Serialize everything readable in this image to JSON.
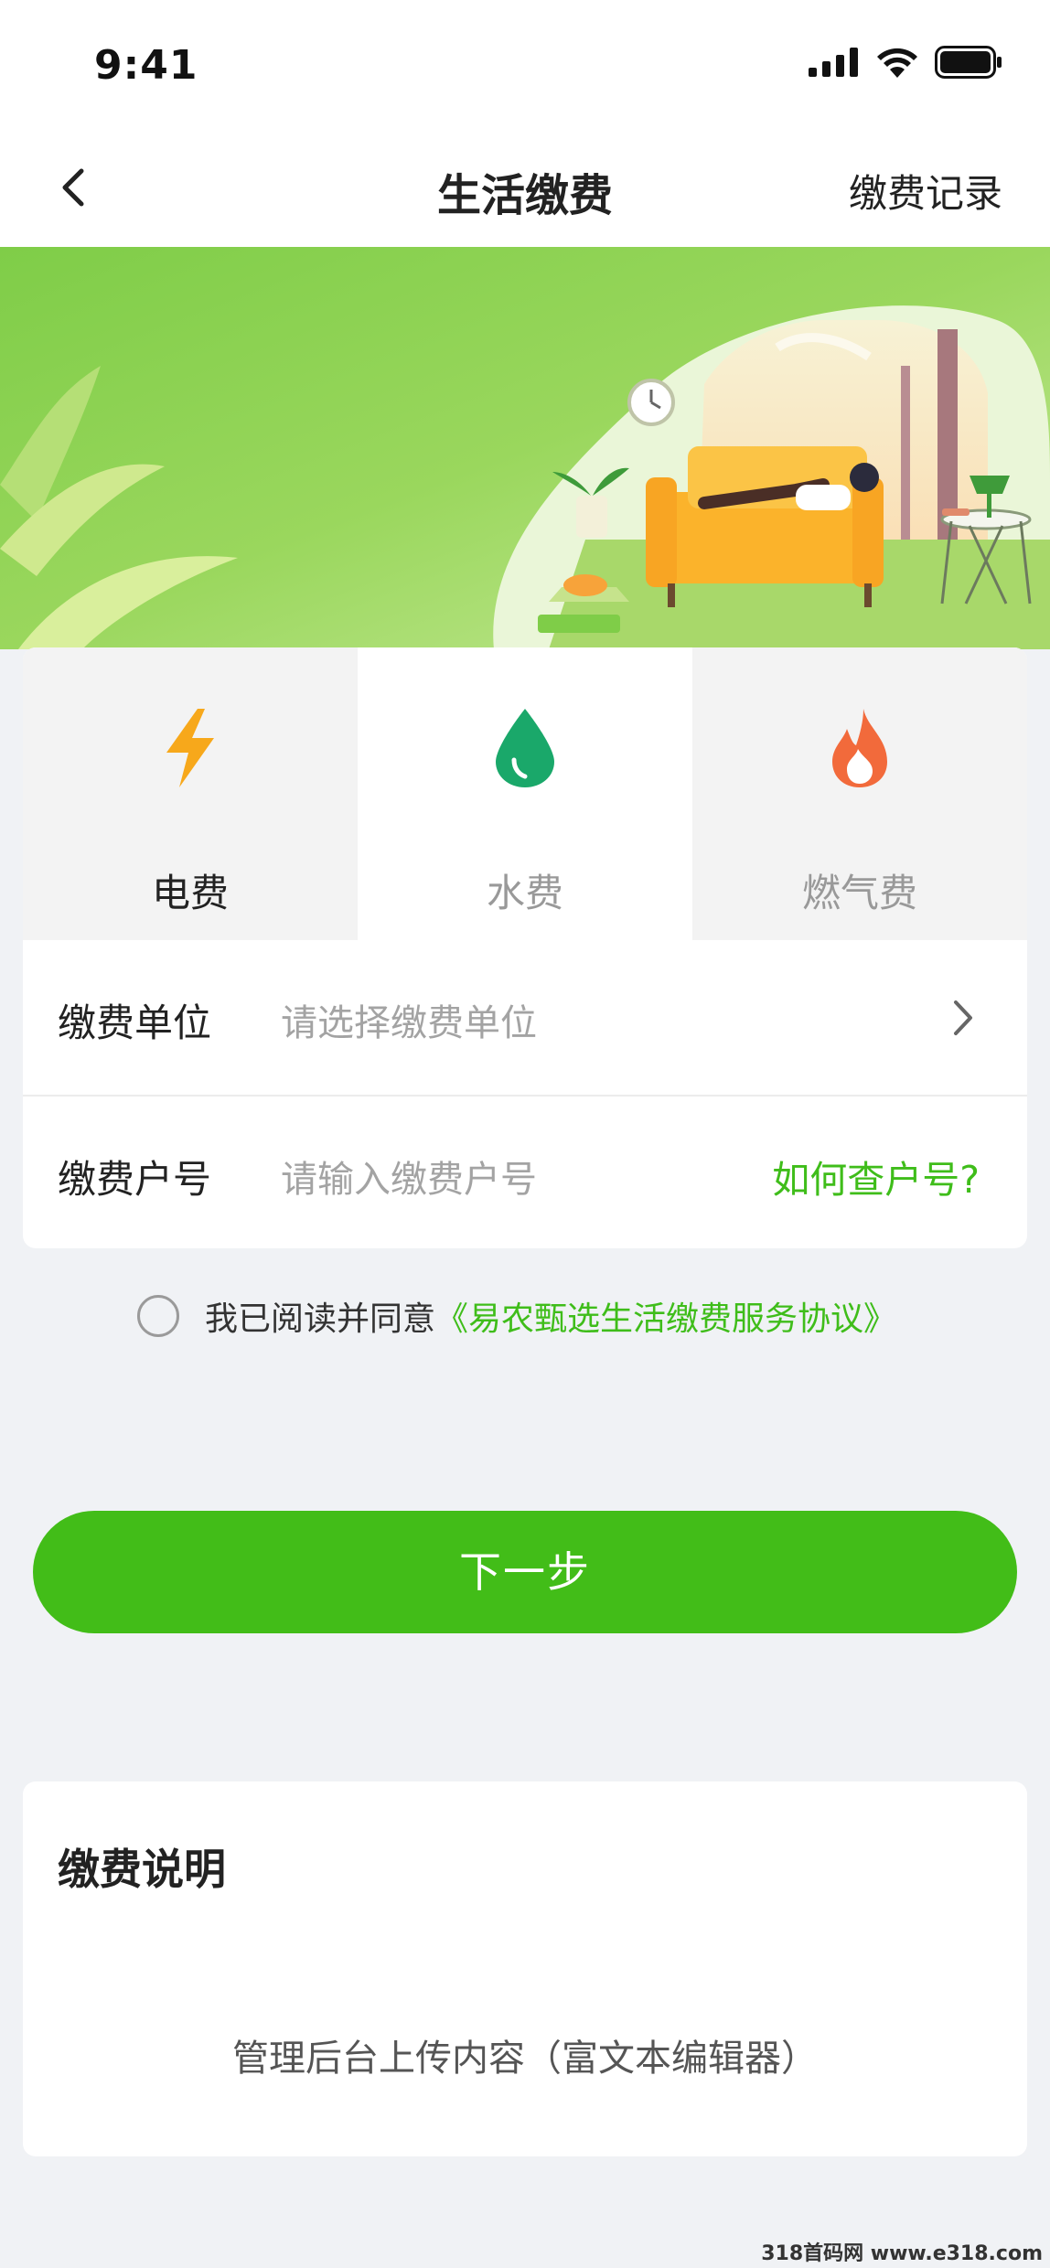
{
  "status_bar": {
    "time": "9:41",
    "icons": [
      "signal-icon",
      "wifi-icon",
      "battery-icon"
    ]
  },
  "navbar": {
    "title": "生活缴费",
    "right_action": "缴费记录",
    "back_icon": "chevron-left-icon"
  },
  "tabs": [
    {
      "label": "电费",
      "icon": "lightning-icon",
      "selected": false
    },
    {
      "label": "水费",
      "icon": "water-drop-icon",
      "selected": true
    },
    {
      "label": "燃气费",
      "icon": "flame-icon",
      "selected": false
    }
  ],
  "form": {
    "unit_label": "缴费单位",
    "unit_placeholder": "请选择缴费单位",
    "account_label": "缴费户号",
    "account_placeholder": "请输入缴费户号",
    "account_help": "如何查户号?"
  },
  "agreement": {
    "text": "我已阅读并同意",
    "link": "《易农甄选生活缴费服务协议》",
    "checked": false
  },
  "next_button": "下一步",
  "payment_info": {
    "title": "缴费说明",
    "content": "管理后台上传内容（富文本编辑器）"
  },
  "watermark": "318首码网 www.e318.com",
  "colors": {
    "accent": "#42bd18",
    "link": "#3fbd1a",
    "lightning": "#f7a81b",
    "water": "#1aa86a",
    "flame": "#f26a3b"
  }
}
